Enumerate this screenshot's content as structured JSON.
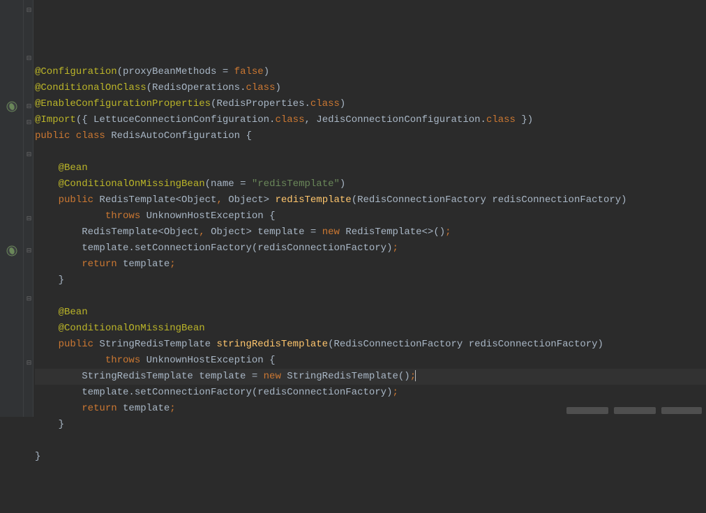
{
  "lines": [
    [
      {
        "cls": "t-anno",
        "t": "@Configuration"
      },
      {
        "cls": "t-plain",
        "t": "("
      },
      {
        "cls": "t-attr",
        "t": "proxyBeanMethods "
      },
      {
        "cls": "t-plain",
        "t": "= "
      },
      {
        "cls": "t-kw",
        "t": "false"
      },
      {
        "cls": "t-plain",
        "t": ")"
      }
    ],
    [
      {
        "cls": "t-anno",
        "t": "@ConditionalOnClass"
      },
      {
        "cls": "t-plain",
        "t": "(RedisOperations."
      },
      {
        "cls": "t-kw",
        "t": "class"
      },
      {
        "cls": "t-plain",
        "t": ")"
      }
    ],
    [
      {
        "cls": "t-anno",
        "t": "@EnableConfigurationProperties"
      },
      {
        "cls": "t-plain",
        "t": "(RedisProperties."
      },
      {
        "cls": "t-kw",
        "t": "class"
      },
      {
        "cls": "t-plain",
        "t": ")"
      }
    ],
    [
      {
        "cls": "t-anno",
        "t": "@Import"
      },
      {
        "cls": "t-plain",
        "t": "({ LettuceConnectionConfiguration."
      },
      {
        "cls": "t-kw",
        "t": "class"
      },
      {
        "cls": "t-plain",
        "t": ", "
      },
      {
        "cls": "t-plain",
        "t": "JedisConnectionConfiguration."
      },
      {
        "cls": "t-kw",
        "t": "class"
      },
      {
        "cls": "t-plain",
        "t": " })"
      }
    ],
    [
      {
        "cls": "t-kw",
        "t": "public class "
      },
      {
        "cls": "t-type",
        "t": "RedisAutoConfiguration "
      },
      {
        "cls": "t-plain",
        "t": "{"
      }
    ],
    [
      {
        "cls": "t-plain",
        "t": ""
      }
    ],
    [
      {
        "cls": "t-anno",
        "t": "    @Bean"
      }
    ],
    [
      {
        "cls": "t-anno",
        "t": "    @ConditionalOnMissingBean"
      },
      {
        "cls": "t-plain",
        "t": "("
      },
      {
        "cls": "t-attr",
        "t": "name "
      },
      {
        "cls": "t-plain",
        "t": "= "
      },
      {
        "cls": "t-str",
        "t": "\"redisTemplate\""
      },
      {
        "cls": "t-plain",
        "t": ")"
      }
    ],
    [
      {
        "cls": "t-kw",
        "t": "    public "
      },
      {
        "cls": "t-type",
        "t": "RedisTemplate<Object"
      },
      {
        "cls": "t-kw",
        "t": ", "
      },
      {
        "cls": "t-type",
        "t": "Object> "
      },
      {
        "cls": "t-method",
        "t": "redisTemplate"
      },
      {
        "cls": "t-plain",
        "t": "(RedisConnectionFactory redisConnectionFactory)"
      }
    ],
    [
      {
        "cls": "t-kw",
        "t": "            throws "
      },
      {
        "cls": "t-type",
        "t": "UnknownHostException "
      },
      {
        "cls": "t-plain",
        "t": "{"
      }
    ],
    [
      {
        "cls": "t-plain",
        "t": "        RedisTemplate<Object"
      },
      {
        "cls": "t-kw",
        "t": ", "
      },
      {
        "cls": "t-plain",
        "t": "Object> template = "
      },
      {
        "cls": "t-kw",
        "t": "new "
      },
      {
        "cls": "t-newcall",
        "t": "RedisTemplate<>()"
      },
      {
        "cls": "t-kw",
        "t": ";"
      }
    ],
    [
      {
        "cls": "t-plain",
        "t": "        template.setConnectionFactory(redisConnectionFactory)"
      },
      {
        "cls": "t-kw",
        "t": ";"
      }
    ],
    [
      {
        "cls": "t-kw",
        "t": "        return "
      },
      {
        "cls": "t-plain",
        "t": "template"
      },
      {
        "cls": "t-kw",
        "t": ";"
      }
    ],
    [
      {
        "cls": "t-plain",
        "t": "    }"
      }
    ],
    [
      {
        "cls": "t-plain",
        "t": ""
      }
    ],
    [
      {
        "cls": "t-anno",
        "t": "    @Bean"
      }
    ],
    [
      {
        "cls": "t-anno",
        "t": "    @ConditionalOnMissingBean"
      }
    ],
    [
      {
        "cls": "t-kw",
        "t": "    public "
      },
      {
        "cls": "t-type",
        "t": "StringRedisTemplate "
      },
      {
        "cls": "t-method",
        "t": "stringRedisTemplate"
      },
      {
        "cls": "t-plain",
        "t": "(RedisConnectionFactory redisConnectionFactory)"
      }
    ],
    [
      {
        "cls": "t-kw",
        "t": "            throws "
      },
      {
        "cls": "t-type",
        "t": "UnknownHostException "
      },
      {
        "cls": "t-plain",
        "t": "{"
      }
    ],
    [
      {
        "cls": "t-plain",
        "t": "        StringRedisTemplate template = "
      },
      {
        "cls": "t-kw",
        "t": "new "
      },
      {
        "cls": "t-newcall",
        "t": "StringRedisTemplate()"
      },
      {
        "cls": "t-kw",
        "t": ";"
      }
    ],
    [
      {
        "cls": "t-plain",
        "t": "        template.setConnectionFactory(redisConnectionFactory)"
      },
      {
        "cls": "t-kw",
        "t": ";"
      }
    ],
    [
      {
        "cls": "t-kw",
        "t": "        return "
      },
      {
        "cls": "t-plain",
        "t": "template"
      },
      {
        "cls": "t-kw",
        "t": ";"
      }
    ],
    [
      {
        "cls": "t-plain",
        "t": "    }"
      }
    ],
    [
      {
        "cls": "t-plain",
        "t": ""
      }
    ],
    [
      {
        "cls": "t-plain",
        "t": "}"
      }
    ]
  ],
  "folds": [
    {
      "row": 0,
      "sym": "⊟"
    },
    {
      "row": 3,
      "sym": "⊟"
    },
    {
      "row": 6,
      "sym": "⊟"
    },
    {
      "row": 7,
      "sym": "⊟"
    },
    {
      "row": 9,
      "sym": "⊟"
    },
    {
      "row": 13,
      "sym": "⊟"
    },
    {
      "row": 15,
      "sym": "⊟"
    },
    {
      "row": 18,
      "sym": "⊟"
    },
    {
      "row": 22,
      "sym": "⊟"
    }
  ],
  "bean_icons": [
    6,
    15
  ],
  "highlight_row": 19,
  "caret_row": 19
}
